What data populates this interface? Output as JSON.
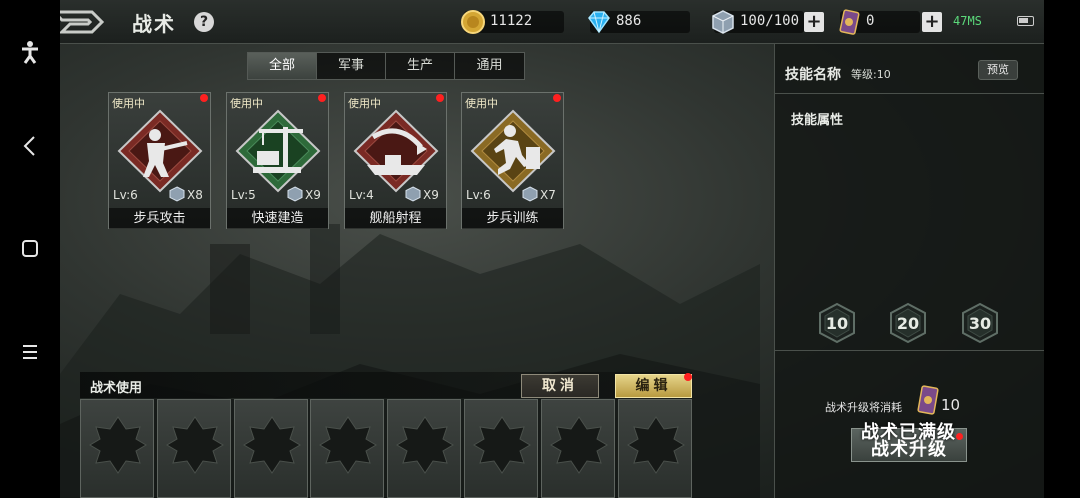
{
  "header": {
    "title": "战术",
    "help_label": "?",
    "gold": "11122",
    "diamonds": "886",
    "crystals": "100/100",
    "cards": "0",
    "fps": "47MS"
  },
  "tabs": [
    {
      "label": "全部",
      "active": true
    },
    {
      "label": "军事",
      "active": false
    },
    {
      "label": "生产",
      "active": false
    },
    {
      "label": "通用",
      "active": false
    }
  ],
  "cards": [
    {
      "status": "使用中",
      "level": "Lv:6",
      "count": "X8",
      "name": "步兵攻击",
      "color": "#7a2a24",
      "icon": "infantry-attack-icon"
    },
    {
      "status": "使用中",
      "level": "Lv:5",
      "count": "X9",
      "name": "快速建造",
      "color": "#2e6a3a",
      "icon": "construction-crane-icon"
    },
    {
      "status": "使用中",
      "level": "Lv:4",
      "count": "X9",
      "name": "舰船射程",
      "color": "#7a2a24",
      "icon": "ship-range-icon"
    },
    {
      "status": "使用中",
      "level": "Lv:6",
      "count": "X7",
      "name": "步兵训练",
      "color": "#8a6a24",
      "icon": "infantry-training-icon"
    }
  ],
  "skill_panel": {
    "name_label": "技能名称",
    "level_label": "等级:10",
    "preview_label": "预览",
    "attr_label": "技能属性",
    "milestones": [
      "10",
      "20",
      "30"
    ],
    "upgrade_cost_label": "战术升级将消耗",
    "upgrade_cost": "10",
    "upgrade_label": "战术升级",
    "maxed_label": "战术已满级"
  },
  "bottom": {
    "use_label": "战术使用",
    "cancel_label": "取消",
    "edit_label": "编辑",
    "slot_count": 8
  },
  "colors": {
    "accent_gold": "#e6d48a",
    "alert_red": "#ff2020",
    "fps_green": "#5bd87a"
  }
}
